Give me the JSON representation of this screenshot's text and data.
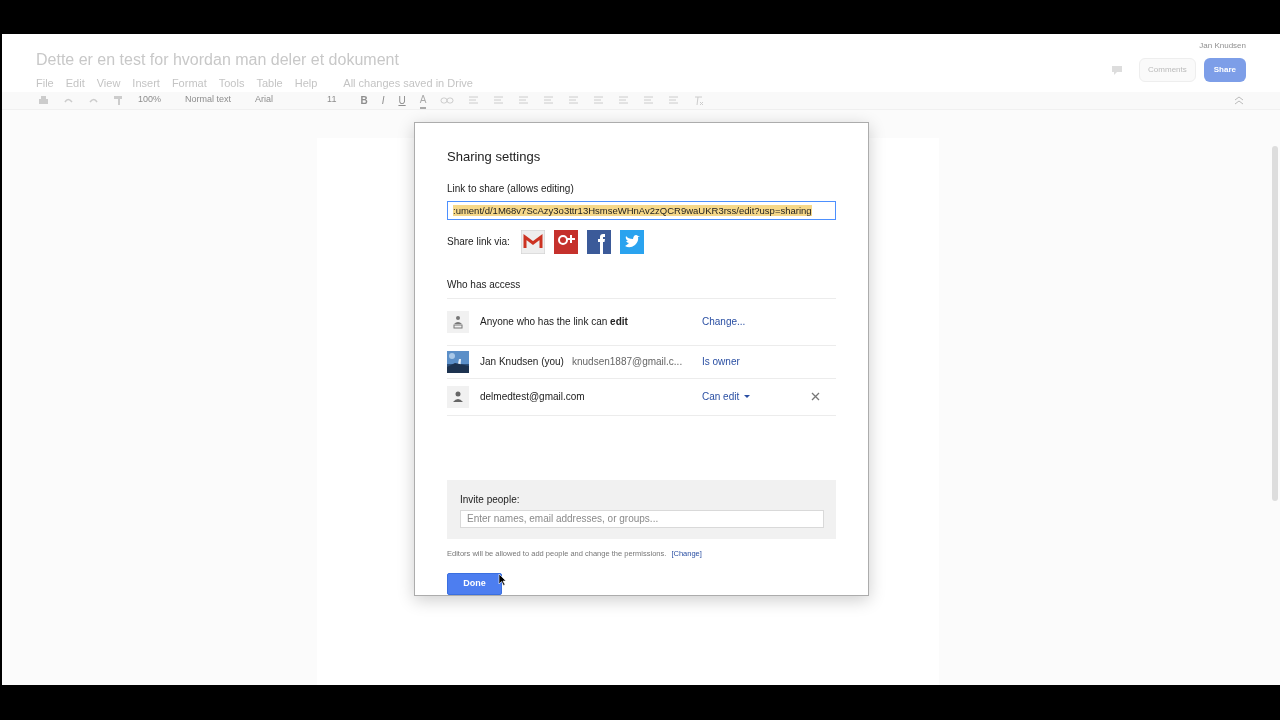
{
  "document": {
    "title": "Dette er en test for hvordan man deler et dokument",
    "menu": [
      "File",
      "Edit",
      "View",
      "Insert",
      "Format",
      "Tools",
      "Table",
      "Help"
    ],
    "save_status": "All changes saved in Drive",
    "user": "Jan Knudsen",
    "comments_button": "Comments",
    "share_button": "Share"
  },
  "toolbar": {
    "zoom": "100%",
    "style": "Normal text",
    "font": "Arial",
    "size": "11",
    "format": [
      "B",
      "I",
      "U",
      "A"
    ]
  },
  "dialog": {
    "title": "Sharing settings",
    "link_label": "Link to share (allows editing)",
    "link_value": ":ument/d/1M68v7ScAzy3o3ttr13HsmseWHnAv2zQCR9waUKR3rss/edit?usp=sharing",
    "share_via_label": "Share link via:",
    "share_services": [
      {
        "kind": "gmail"
      },
      {
        "kind": "gplus"
      },
      {
        "kind": "facebook"
      },
      {
        "kind": "twitter"
      }
    ],
    "access_heading": "Who has access",
    "access": [
      {
        "kind": "link",
        "text": "Anyone who has the link can **edit**",
        "role": "Change...",
        "dropdown": false,
        "removable": false
      },
      {
        "kind": "owner",
        "text": "Jan Knudsen (you)",
        "email": "knudsen1887@gmail.c...",
        "role": "Is owner",
        "dropdown": false,
        "removable": false
      },
      {
        "kind": "user",
        "text": "delmedtest@gmail.com",
        "role": "Can edit",
        "dropdown": true,
        "removable": true
      }
    ],
    "invite_label": "Invite people:",
    "invite_placeholder": "Enter names, email addresses, or groups...",
    "note": "Editors will be allowed to add people and change the permissions.",
    "note_link": "[Change]",
    "done_button": "Done"
  }
}
